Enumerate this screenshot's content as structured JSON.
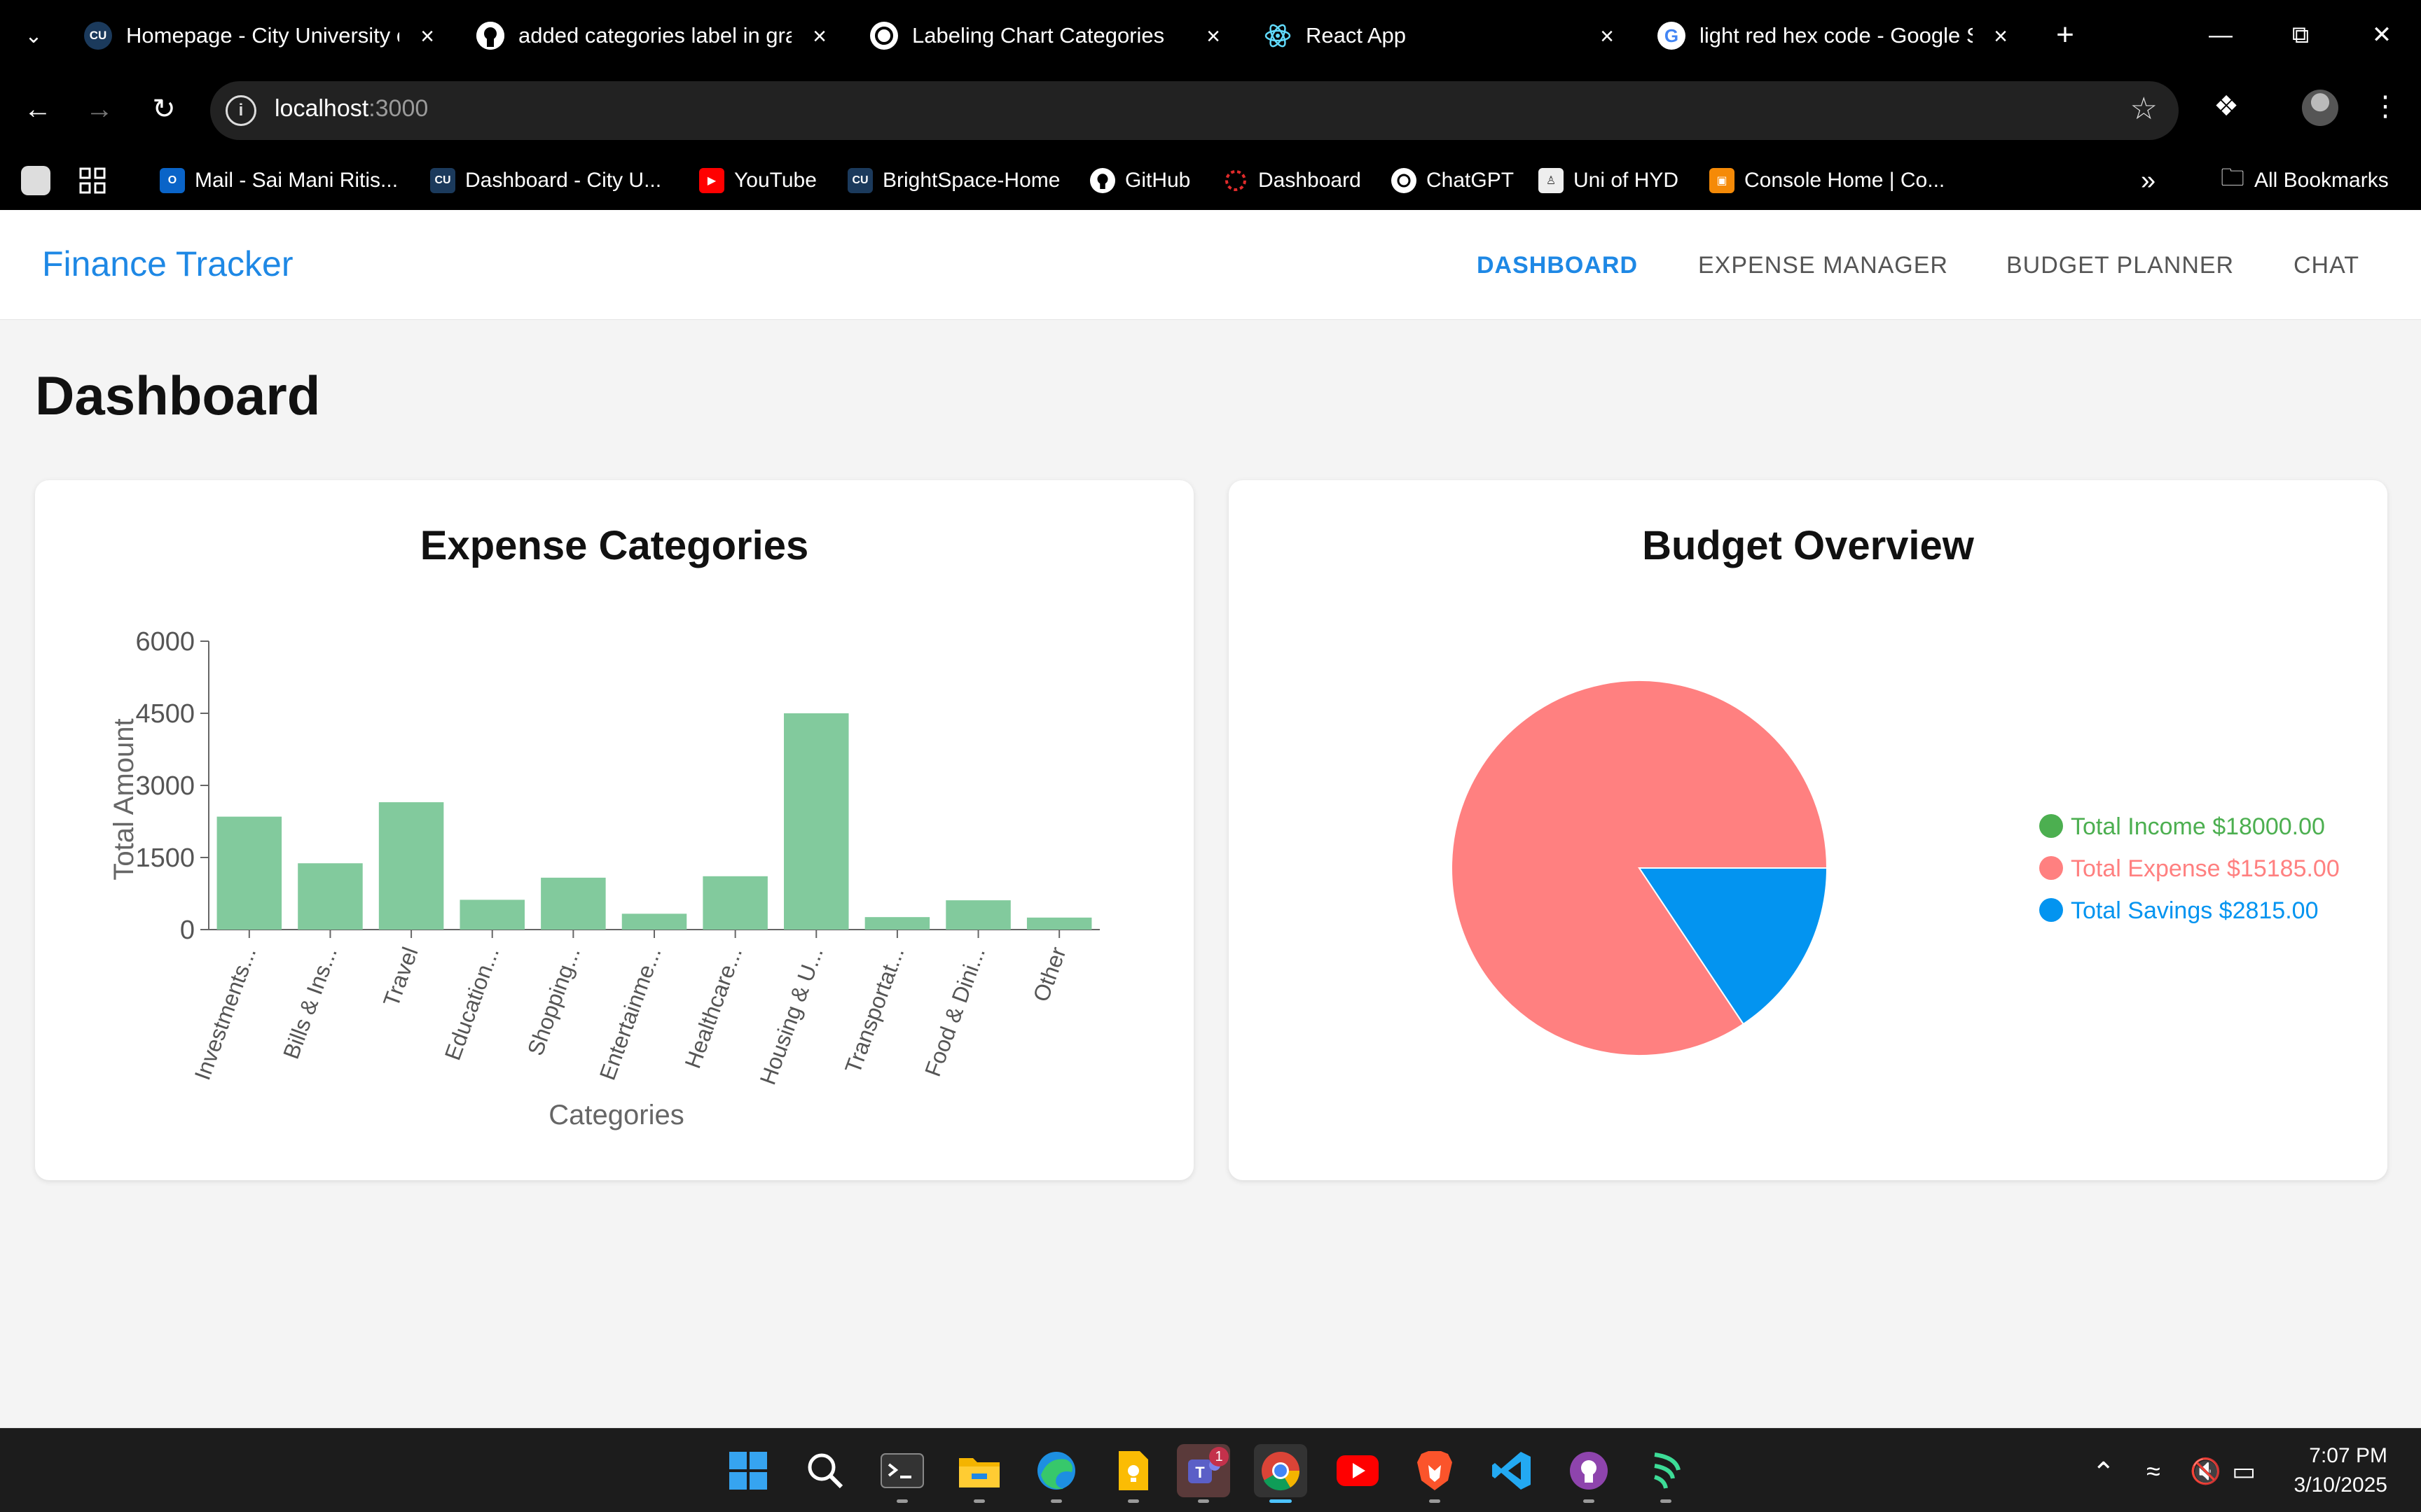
{
  "browser": {
    "tabs": [
      {
        "title": "Homepage - City University of Hong Kong",
        "favicon": "CU",
        "favicon_bg": "#1b3a5c"
      },
      {
        "title": "added categories label in graph",
        "favicon": "github-icon",
        "favicon_bg": "#ffffff"
      },
      {
        "title": "Labeling Chart Categories",
        "favicon": "chatgpt-icon",
        "favicon_bg": "#ffffff"
      },
      {
        "title": "React App",
        "favicon": "react-icon",
        "favicon_bg": "#000000"
      },
      {
        "title": "light red hex code - Google Search",
        "favicon": "google-icon",
        "favicon_bg": "#ffffff"
      }
    ],
    "new_tab": "+",
    "url_host": "localhost",
    "url_port": ":3000",
    "bookmarks": [
      {
        "label": "Mail - Sai Mani Ritis...",
        "icon": "outlook-icon",
        "color": "#0a64c8"
      },
      {
        "label": "Dashboard - City U...",
        "icon": "CU",
        "color": "#1b3a5c"
      },
      {
        "label": "YouTube",
        "icon": "youtube-icon",
        "color": "#ff0000"
      },
      {
        "label": "BrightSpace-Home",
        "icon": "CU",
        "color": "#1b3a5c"
      },
      {
        "label": "GitHub",
        "icon": "github-icon",
        "color": "#ffffff"
      },
      {
        "label": "Dashboard",
        "icon": "canvas-icon",
        "color": "#e02b2b"
      },
      {
        "label": "ChatGPT",
        "icon": "chatgpt-icon",
        "color": "#ffffff"
      },
      {
        "label": "Uni of HYD",
        "icon": "uni-icon",
        "color": "#eeeeee"
      },
      {
        "label": "Console Home | Co...",
        "icon": "aws-icon",
        "color": "#f58a07"
      }
    ],
    "bookmarks_overflow": "»",
    "all_bookmarks": "All Bookmarks"
  },
  "app": {
    "brand": "Finance Tracker",
    "nav": [
      "DASHBOARD",
      "EXPENSE MANAGER",
      "BUDGET PLANNER",
      "CHAT"
    ],
    "active_nav": "DASHBOARD",
    "page_title": "Dashboard",
    "accent": "#1e88e5"
  },
  "chart_data": [
    {
      "type": "bar",
      "title": "Expense Categories",
      "xlabel": "Categories",
      "ylabel": "Total Amount",
      "categories": [
        "Investments...",
        "Bills & Ins...",
        "Travel",
        "Education...",
        "Shopping...",
        "Entertainme...",
        "Healthcare...",
        "Housing & U...",
        "Transportat...",
        "Food & Dini...",
        "Other"
      ],
      "values": [
        2350,
        1380,
        2650,
        620,
        1080,
        330,
        1110,
        4500,
        260,
        610,
        250
      ],
      "yticks": [
        0,
        1500,
        3000,
        4500,
        6000
      ],
      "ylim": [
        0,
        6000
      ],
      "bar_color": "#82ca9d",
      "grid": false
    },
    {
      "type": "pie",
      "title": "Budget Overview",
      "legend_placement": "right",
      "slices": [
        {
          "label": "Total Expense",
          "value": 15185,
          "color": "#ff8080"
        },
        {
          "label": "Total Savings",
          "value": 2815,
          "color": "#0394f0"
        }
      ],
      "legend": [
        {
          "label": "Total Income $18000.00",
          "color": "#4caf50"
        },
        {
          "label": "Total Expense $15185.00",
          "color": "#ff8080"
        },
        {
          "label": "Total Savings $2815.00",
          "color": "#0394f0"
        }
      ]
    }
  ],
  "taskbar": {
    "apps": [
      "windows-icon",
      "search-icon",
      "terminal-icon",
      "file-explorer-icon",
      "edge-icon",
      "keep-icon",
      "teams-icon",
      "chrome-icon",
      "youtube-icon",
      "brave-icon",
      "vscode-icon",
      "github-desktop-icon",
      "app-icon"
    ],
    "teams_badge": "1",
    "time": "7:07 PM",
    "date": "3/10/2025"
  }
}
